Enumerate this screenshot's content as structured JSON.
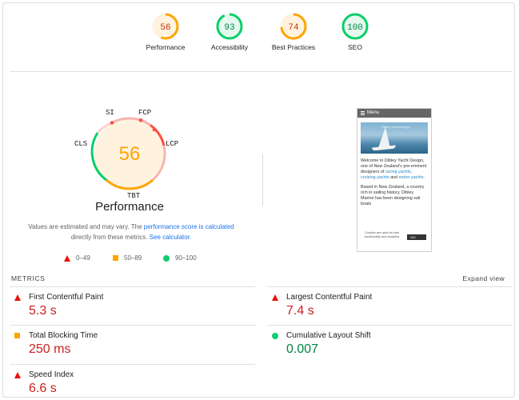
{
  "colors": {
    "fail": "#ff4e42",
    "average": "#ffa400",
    "pass": "#0cce6b",
    "fail_text": "#c7221f",
    "pass_text": "#018642",
    "average_text": "#c33300"
  },
  "categories": [
    {
      "label": "Performance",
      "score": 56,
      "status": "average"
    },
    {
      "label": "Accessibility",
      "score": 93,
      "status": "pass"
    },
    {
      "label": "Best Practices",
      "score": 74,
      "status": "average"
    },
    {
      "label": "SEO",
      "score": 100,
      "status": "pass"
    }
  ],
  "main_gauge": {
    "score": 56,
    "title": "Performance",
    "tags": {
      "si": "SI",
      "fcp": "FCP",
      "lcp": "LCP",
      "cls": "CLS",
      "tbt": "TBT"
    }
  },
  "disclaimer": {
    "pre": "Values are estimated and may vary. The ",
    "link1": "performance score is calculated",
    "mid": " directly from these metrics. ",
    "link2": "See calculator."
  },
  "legend": [
    {
      "icon": "triangle-icon",
      "label": "0–49"
    },
    {
      "icon": "square-icon",
      "label": "50–89"
    },
    {
      "icon": "circle-icon",
      "label": "90–100"
    }
  ],
  "screenshot": {
    "menu_label": "Menu",
    "hero_caption": "Dibley Yacht Design",
    "para1_pre": "Welcome to Dibley Yacht Design, one of New Zealand's pre-eminent designers of ",
    "link_racing": "racing yachts",
    "para1_sep": ", ",
    "link_cruising": "cruising yachts",
    "para1_and": " and ",
    "link_motor": "motor yachts",
    "para1_end": ".",
    "para2": "Based in New Zealand, a country rich in sailing history, Dibley Marine has been designing sail boats",
    "cookie_text": "Cookies are used for web functionality and analytics",
    "cookie_button": "OK!"
  },
  "metrics_header": "METRICS",
  "expand_label": "Expand view",
  "metrics": [
    {
      "name": "First Contentful Paint",
      "value": "5.3 s",
      "status": "fail"
    },
    {
      "name": "Largest Contentful Paint",
      "value": "7.4 s",
      "status": "fail"
    },
    {
      "name": "Total Blocking Time",
      "value": "250 ms",
      "status": "average"
    },
    {
      "name": "Cumulative Layout Shift",
      "value": "0.007",
      "status": "pass"
    },
    {
      "name": "Speed Index",
      "value": "6.6 s",
      "status": "fail"
    }
  ]
}
